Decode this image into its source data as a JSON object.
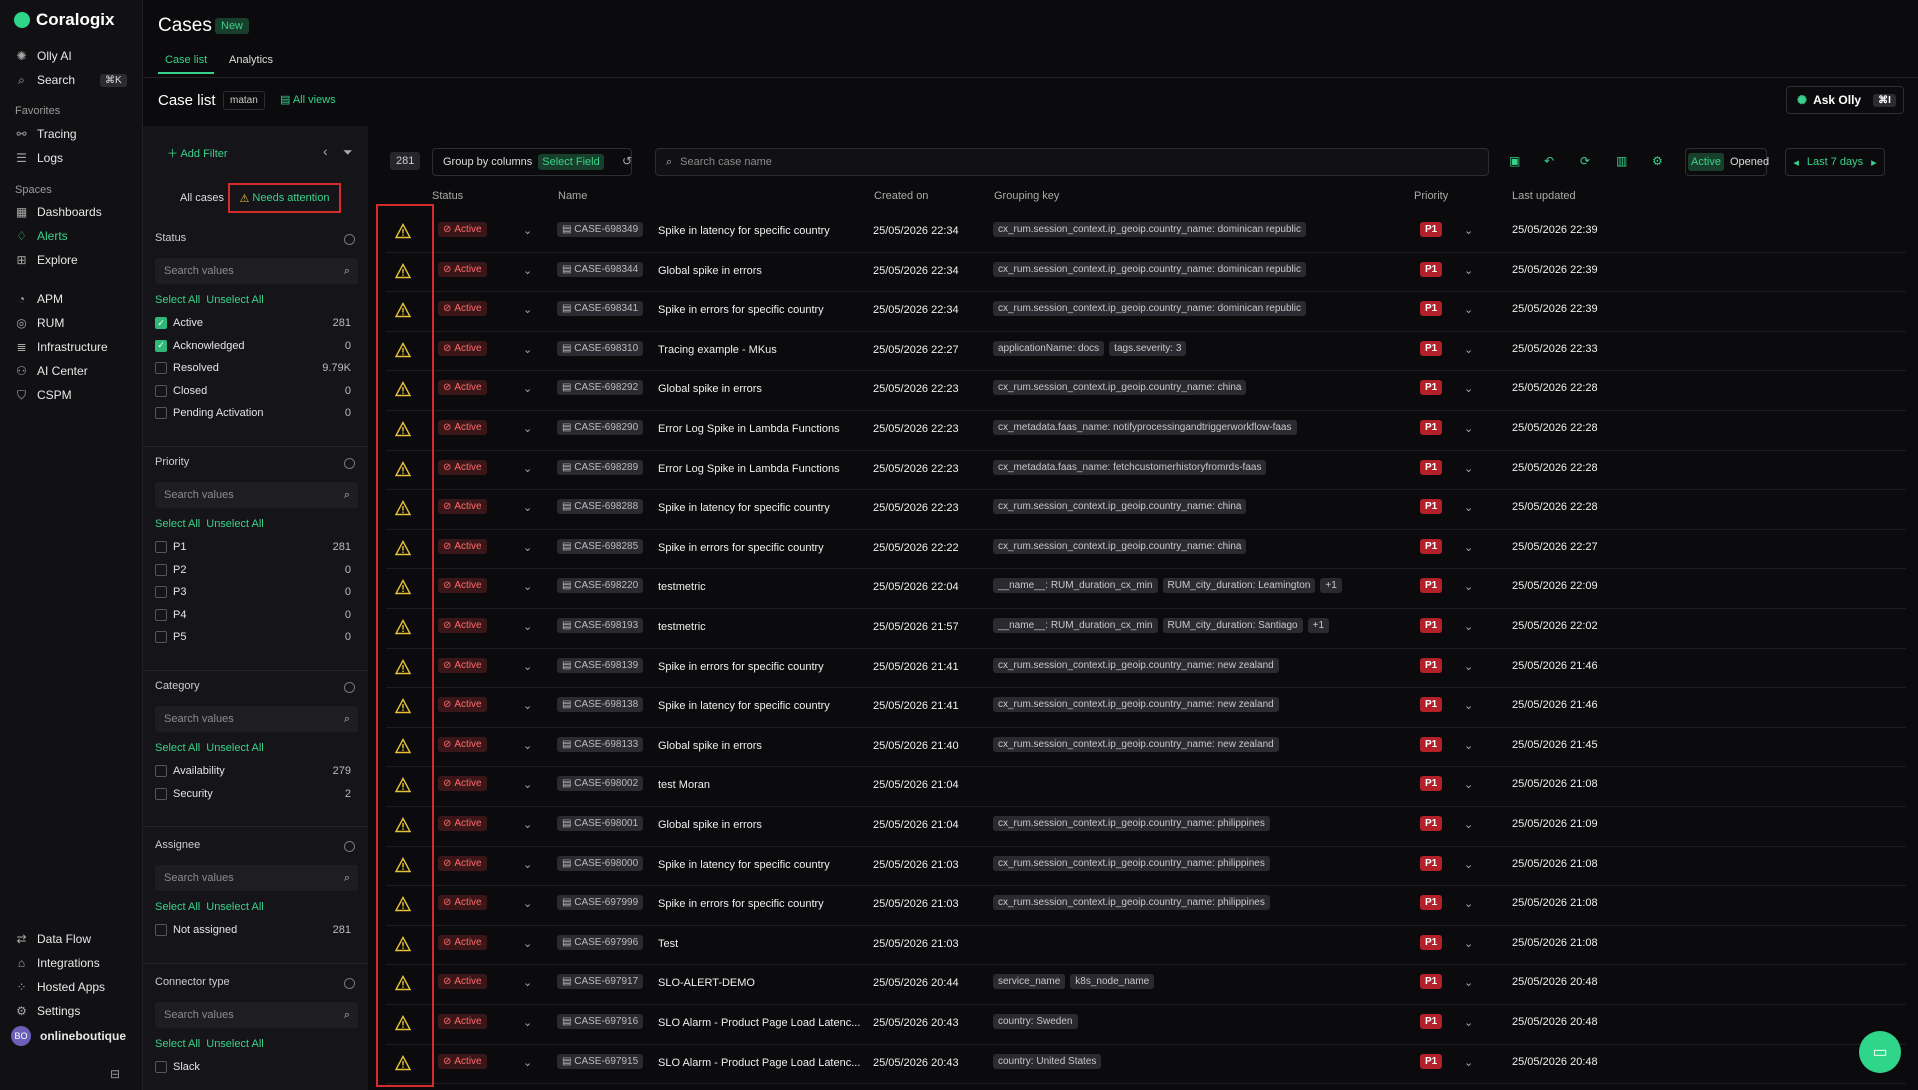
{
  "app": {
    "brand": "Coralogix"
  },
  "nav": {
    "top": [
      {
        "label": "Olly AI",
        "icon": "olly-icon"
      },
      {
        "label": "Search",
        "icon": "search-icon",
        "kbd": "⌘K"
      }
    ],
    "favorites_label": "Favorites",
    "favorites": [
      {
        "label": "Tracing",
        "icon": "tracing-icon"
      },
      {
        "label": "Logs",
        "icon": "logs-icon"
      }
    ],
    "spaces_label": "Spaces",
    "spaces": [
      {
        "label": "Dashboards",
        "icon": "dashboards-icon"
      },
      {
        "label": "Alerts",
        "icon": "bell-icon",
        "active": true
      },
      {
        "label": "Explore",
        "icon": "explore-icon"
      }
    ],
    "products": [
      {
        "label": "APM",
        "icon": "apm-icon"
      },
      {
        "label": "RUM",
        "icon": "rum-icon"
      },
      {
        "label": "Infrastructure",
        "icon": "infrastructure-icon"
      },
      {
        "label": "AI Center",
        "icon": "ai-center-icon"
      },
      {
        "label": "CSPM",
        "icon": "cspm-icon"
      }
    ],
    "bottom": [
      {
        "label": "Data Flow",
        "icon": "data-flow-icon"
      },
      {
        "label": "Integrations",
        "icon": "integrations-icon"
      },
      {
        "label": "Hosted Apps",
        "icon": "hosted-apps-icon"
      },
      {
        "label": "Settings",
        "icon": "gear-icon"
      }
    ],
    "account": {
      "initials": "BO",
      "name": "onlineboutique"
    }
  },
  "header": {
    "title": "Cases",
    "badge": "New",
    "tabs": [
      "Case list",
      "Analytics"
    ],
    "subtitle": "Case list",
    "view_chip": "matan",
    "all_views": "All views",
    "ask_olly": "Ask Olly",
    "ask_kbd": "⌘I"
  },
  "filters": {
    "add_filter": "Add Filter",
    "segments": {
      "all": "All cases",
      "needs": "Needs attention"
    },
    "select_all": "Select All",
    "unselect_all": "Unselect All",
    "search_placeholder": "Search values",
    "status": {
      "title": "Status",
      "options": [
        {
          "label": "Active",
          "count": "281",
          "checked": true
        },
        {
          "label": "Acknowledged",
          "count": "0",
          "checked": true
        },
        {
          "label": "Resolved",
          "count": "9.79K",
          "checked": false
        },
        {
          "label": "Closed",
          "count": "0",
          "checked": false
        },
        {
          "label": "Pending Activation",
          "count": "0",
          "checked": false
        }
      ]
    },
    "priority": {
      "title": "Priority",
      "options": [
        {
          "label": "P1",
          "count": "281"
        },
        {
          "label": "P2",
          "count": "0"
        },
        {
          "label": "P3",
          "count": "0"
        },
        {
          "label": "P4",
          "count": "0"
        },
        {
          "label": "P5",
          "count": "0"
        }
      ]
    },
    "category": {
      "title": "Category",
      "options": [
        {
          "label": "Availability",
          "count": "279"
        },
        {
          "label": "Security",
          "count": "2"
        }
      ]
    },
    "assignee": {
      "title": "Assignee",
      "options": [
        {
          "label": "Not assigned",
          "count": "281"
        }
      ]
    },
    "connector": {
      "title": "Connector type",
      "options": [
        {
          "label": "Slack",
          "count": ""
        }
      ]
    }
  },
  "toolbar": {
    "count": "281",
    "group_by": "Group by columns",
    "select_field": "Select Field",
    "search_placeholder": "Search case name",
    "active": "Active",
    "opened": "Opened",
    "range": "Last 7 days"
  },
  "table": {
    "columns": [
      "Status",
      "Name",
      "Created on",
      "Grouping key",
      "Priority",
      "Last updated"
    ],
    "rows": [
      {
        "status": "Active",
        "id": "CASE-698349",
        "name": "Spike in latency for specific country",
        "created": "25/05/2026 22:34",
        "keys": [
          "cx_rum.session_context.ip_geoip.country_name: dominican republic"
        ],
        "priority": "P1",
        "updated": "25/05/2026 22:39"
      },
      {
        "status": "Active",
        "id": "CASE-698344",
        "name": "Global spike in errors",
        "created": "25/05/2026 22:34",
        "keys": [
          "cx_rum.session_context.ip_geoip.country_name: dominican republic"
        ],
        "priority": "P1",
        "updated": "25/05/2026 22:39"
      },
      {
        "status": "Active",
        "id": "CASE-698341",
        "name": "Spike in errors for specific country",
        "created": "25/05/2026 22:34",
        "keys": [
          "cx_rum.session_context.ip_geoip.country_name: dominican republic"
        ],
        "priority": "P1",
        "updated": "25/05/2026 22:39"
      },
      {
        "status": "Active",
        "id": "CASE-698310",
        "name": "Tracing example - MKus",
        "created": "25/05/2026 22:27",
        "keys": [
          "applicationName: docs",
          "tags.severity: 3"
        ],
        "priority": "P1",
        "updated": "25/05/2026 22:33"
      },
      {
        "status": "Active",
        "id": "CASE-698292",
        "name": "Global spike in errors",
        "created": "25/05/2026 22:23",
        "keys": [
          "cx_rum.session_context.ip_geoip.country_name: china"
        ],
        "priority": "P1",
        "updated": "25/05/2026 22:28"
      },
      {
        "status": "Active",
        "id": "CASE-698290",
        "name": "Error Log Spike in Lambda Functions",
        "created": "25/05/2026 22:23",
        "keys": [
          "cx_metadata.faas_name: notifyprocessingandtriggerworkflow-faas"
        ],
        "priority": "P1",
        "updated": "25/05/2026 22:28"
      },
      {
        "status": "Active",
        "id": "CASE-698289",
        "name": "Error Log Spike in Lambda Functions",
        "created": "25/05/2026 22:23",
        "keys": [
          "cx_metadata.faas_name: fetchcustomerhistoryfromrds-faas"
        ],
        "priority": "P1",
        "updated": "25/05/2026 22:28"
      },
      {
        "status": "Active",
        "id": "CASE-698288",
        "name": "Spike in latency for specific country",
        "created": "25/05/2026 22:23",
        "keys": [
          "cx_rum.session_context.ip_geoip.country_name: china"
        ],
        "priority": "P1",
        "updated": "25/05/2026 22:28"
      },
      {
        "status": "Active",
        "id": "CASE-698285",
        "name": "Spike in errors for specific country",
        "created": "25/05/2026 22:22",
        "keys": [
          "cx_rum.session_context.ip_geoip.country_name: china"
        ],
        "priority": "P1",
        "updated": "25/05/2026 22:27"
      },
      {
        "status": "Active",
        "id": "CASE-698220",
        "name": "testmetric",
        "created": "25/05/2026 22:04",
        "keys": [
          "__name__: RUM_duration_cx_min",
          "RUM_city_duration: Leamington",
          "+1"
        ],
        "priority": "P1",
        "updated": "25/05/2026 22:09"
      },
      {
        "status": "Active",
        "id": "CASE-698193",
        "name": "testmetric",
        "created": "25/05/2026 21:57",
        "keys": [
          "__name__: RUM_duration_cx_min",
          "RUM_city_duration: Santiago",
          "+1"
        ],
        "priority": "P1",
        "updated": "25/05/2026 22:02"
      },
      {
        "status": "Active",
        "id": "CASE-698139",
        "name": "Spike in errors for specific country",
        "created": "25/05/2026 21:41",
        "keys": [
          "cx_rum.session_context.ip_geoip.country_name: new zealand"
        ],
        "priority": "P1",
        "updated": "25/05/2026 21:46"
      },
      {
        "status": "Active",
        "id": "CASE-698138",
        "name": "Spike in latency for specific country",
        "created": "25/05/2026 21:41",
        "keys": [
          "cx_rum.session_context.ip_geoip.country_name: new zealand"
        ],
        "priority": "P1",
        "updated": "25/05/2026 21:46"
      },
      {
        "status": "Active",
        "id": "CASE-698133",
        "name": "Global spike in errors",
        "created": "25/05/2026 21:40",
        "keys": [
          "cx_rum.session_context.ip_geoip.country_name: new zealand"
        ],
        "priority": "P1",
        "updated": "25/05/2026 21:45"
      },
      {
        "status": "Active",
        "id": "CASE-698002",
        "name": "test Moran",
        "created": "25/05/2026 21:04",
        "keys": [],
        "priority": "P1",
        "updated": "25/05/2026 21:08"
      },
      {
        "status": "Active",
        "id": "CASE-698001",
        "name": "Global spike in errors",
        "created": "25/05/2026 21:04",
        "keys": [
          "cx_rum.session_context.ip_geoip.country_name: philippines"
        ],
        "priority": "P1",
        "updated": "25/05/2026 21:09"
      },
      {
        "status": "Active",
        "id": "CASE-698000",
        "name": "Spike in latency for specific country",
        "created": "25/05/2026 21:03",
        "keys": [
          "cx_rum.session_context.ip_geoip.country_name: philippines"
        ],
        "priority": "P1",
        "updated": "25/05/2026 21:08"
      },
      {
        "status": "Active",
        "id": "CASE-697999",
        "name": "Spike in errors for specific country",
        "created": "25/05/2026 21:03",
        "keys": [
          "cx_rum.session_context.ip_geoip.country_name: philippines"
        ],
        "priority": "P1",
        "updated": "25/05/2026 21:08"
      },
      {
        "status": "Active",
        "id": "CASE-697996",
        "name": "Test",
        "created": "25/05/2026 21:03",
        "keys": [],
        "priority": "P1",
        "updated": "25/05/2026 21:08"
      },
      {
        "status": "Active",
        "id": "CASE-697917",
        "name": "SLO-ALERT-DEMO",
        "created": "25/05/2026 20:44",
        "keys": [
          "service_name",
          "k8s_node_name"
        ],
        "priority": "P1",
        "updated": "25/05/2026 20:48"
      },
      {
        "status": "Active",
        "id": "CASE-697916",
        "name": "SLO Alarm - Product Page Load Latenc...",
        "created": "25/05/2026 20:43",
        "keys": [
          "country: Sweden"
        ],
        "priority": "P1",
        "updated": "25/05/2026 20:48"
      },
      {
        "status": "Active",
        "id": "CASE-697915",
        "name": "SLO Alarm - Product Page Load Latenc...",
        "created": "25/05/2026 20:43",
        "keys": [
          "country: United States"
        ],
        "priority": "P1",
        "updated": "25/05/2026 20:48"
      }
    ]
  }
}
